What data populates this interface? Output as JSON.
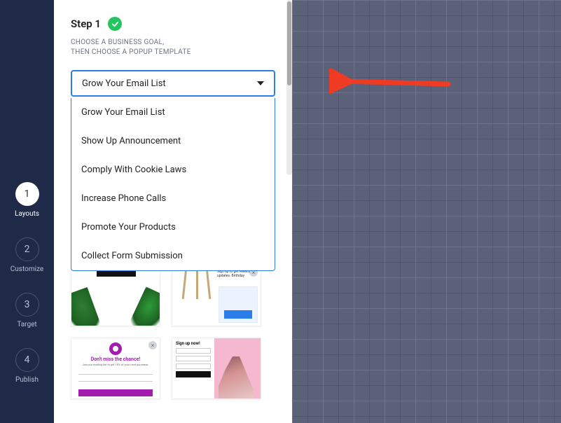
{
  "sidebar": {
    "steps": [
      {
        "num": "1",
        "label": "Layouts",
        "active": true
      },
      {
        "num": "2",
        "label": "Customize",
        "active": false
      },
      {
        "num": "3",
        "label": "Target",
        "active": false
      },
      {
        "num": "4",
        "label": "Publish",
        "active": false
      }
    ]
  },
  "panel": {
    "step_title": "Step 1",
    "subtitle_line1": "CHOOSE A BUSINESS GOAL,",
    "subtitle_line2": "THEN CHOOSE A POPUP TEMPLATE",
    "dropdown": {
      "selected": "Grow Your Email List",
      "options": [
        "Grow Your Email List",
        "Show Up Announcement",
        "Comply With Cookie Laws",
        "Increase Phone Calls",
        "Promote Your Products",
        "Collect Form Submission"
      ]
    },
    "templates": {
      "card_b_text": "Sign up to get weekly updates. Birthday",
      "card_c_headline": "Don't miss the chance!",
      "card_c_sub": "Join our mailing list to get 15% of your next purchase.",
      "card_d_title": "Sign up now!"
    }
  },
  "colors": {
    "accent": "#2b7de9",
    "success": "#22c55e",
    "arrow": "#ef3b24",
    "sidebar_bg": "#1e2a47",
    "canvas_bg": "#5a6178"
  }
}
